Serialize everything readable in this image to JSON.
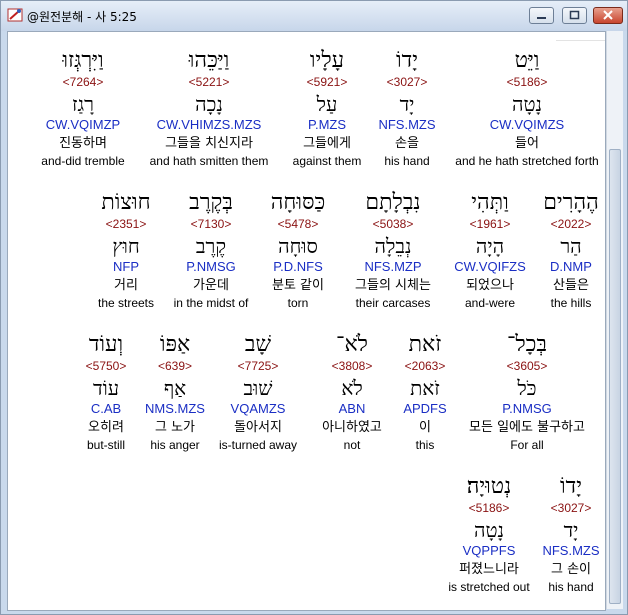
{
  "window": {
    "title": "@원전분해 - 사 5:25",
    "minimize_label": "minimize",
    "maximize_label": "maximize",
    "close_label": "close"
  },
  "rows": [
    [
      {
        "heb": "וַיִּרְגְּזוּ",
        "num": "<7264>",
        "lex": "רָגַז",
        "code": "CW.VQIMZP",
        "kor": "진동하며",
        "eng": "and-did tremble"
      },
      {
        "heb": "וַיַּכֵּהוּ",
        "num": "<5221>",
        "lex": "נָכָה",
        "code": "CW.VHIMZS.MZS",
        "kor": "그들을 치신지라",
        "eng": "and hath smitten them"
      },
      {
        "heb": "עָלָיו",
        "num": "<5921>",
        "lex": "עַל",
        "code": "P.MZS",
        "kor": "그들에게",
        "eng": "against them"
      },
      {
        "heb": "יָדוֹ",
        "num": "<3027>",
        "lex": "יָד",
        "code": "NFS.MZS",
        "kor": "손을",
        "eng": "his hand"
      },
      {
        "heb": "וַיֵּט",
        "num": "<5186>",
        "lex": "נָטָה",
        "code": "CW.VQIMZS",
        "kor": "들어",
        "eng": "and he hath stretched forth"
      }
    ],
    [
      {
        "heb": "חוּצוֹת",
        "num": "<2351>",
        "lex": "חוּץ",
        "code": "NFP",
        "kor": "거리",
        "eng": "the streets"
      },
      {
        "heb": "בְּקֶרֶב",
        "num": "<7130>",
        "lex": "קֶרֶב",
        "code": "P.NMSG",
        "kor": "가운데",
        "eng": "in the midst of"
      },
      {
        "heb": "כַּסּוּחָה",
        "num": "<5478>",
        "lex": "סוּחָה",
        "code": "P.D.NFS",
        "kor": "분토 같이",
        "eng": "torn"
      },
      {
        "heb": "נִבְלָתָם",
        "num": "<5038>",
        "lex": "נְבֵלָה",
        "code": "NFS.MZP",
        "kor": "그들의 시체는",
        "eng": "their carcases"
      },
      {
        "heb": "וַתְּהִי",
        "num": "<1961>",
        "lex": "הָיָה",
        "code": "CW.VQIFZS",
        "kor": "되었으나",
        "eng": "and-were"
      },
      {
        "heb": "הֶהָרִים",
        "num": "<2022>",
        "lex": "הַר",
        "code": "D.NMP",
        "kor": "산들은",
        "eng": "the hills"
      }
    ],
    [
      {
        "heb": "וְעוֹד",
        "num": "<5750>",
        "lex": "עוֹד",
        "code": "C.AB",
        "kor": "오히려",
        "eng": "but-still"
      },
      {
        "heb": "אַפּוֹ",
        "num": "<639>",
        "lex": "אַף",
        "code": "NMS.MZS",
        "kor": "그 노가",
        "eng": "his anger"
      },
      {
        "heb": "שָׁב",
        "num": "<7725>",
        "lex": "שׁוּב",
        "code": "VQAMZS",
        "kor": "돌아서지",
        "eng": "is-turned away"
      },
      {
        "heb": "לֹא־",
        "num": "<3808>",
        "lex": "לֹא",
        "code": "ABN",
        "kor": "아니하였고",
        "eng": "not"
      },
      {
        "heb": "זֹאת",
        "num": "<2063>",
        "lex": "זֹאת",
        "code": "APDFS",
        "kor": "이",
        "eng": "this"
      },
      {
        "heb": "בְּכָל־",
        "num": "<3605>",
        "lex": "כֹּל",
        "code": "P.NMSG",
        "kor": "모든 일에도 불구하고",
        "eng": "For all"
      }
    ],
    [
      {
        "heb": "נְטוּיָה׃",
        "num": "<5186>",
        "lex": "נָטָה",
        "code": "VQPPFS",
        "kor": "퍼졌느니라",
        "eng": "is stretched out"
      },
      {
        "heb": "יָדוֹ",
        "num": "<3027>",
        "lex": "יָד",
        "code": "NFS.MZS",
        "kor": "그 손이",
        "eng": "his hand"
      }
    ]
  ]
}
